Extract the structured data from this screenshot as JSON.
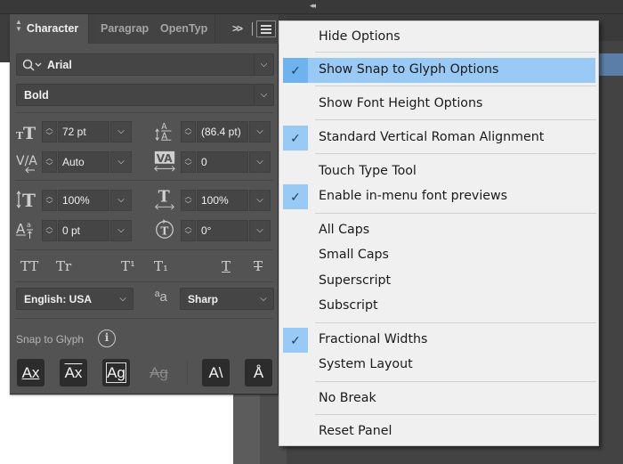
{
  "panel": {
    "tabs": [
      {
        "label": "Character",
        "active": true
      },
      {
        "label": "Paragrap",
        "active": false
      },
      {
        "label": "OpenTyp",
        "active": false
      }
    ],
    "more_tabs_icon": "double-chevron-right-icon",
    "menu_icon": "hamburger-menu-icon",
    "font_family": "Arial",
    "font_style": "Bold",
    "fields": {
      "font_size": "72 pt",
      "leading": "(86.4 pt)",
      "kerning": "Auto",
      "tracking": "0",
      "vertical_scale": "100%",
      "horizontal_scale": "100%",
      "baseline_shift": "0 pt",
      "rotation": "0°"
    },
    "style_buttons": [
      {
        "label": "TT",
        "name": "all-caps"
      },
      {
        "label": "Tr",
        "name": "small-caps"
      },
      {
        "label": "T¹",
        "name": "superscript"
      },
      {
        "label": "T₁",
        "name": "subscript"
      },
      {
        "label": "T",
        "name": "underline"
      },
      {
        "label": "T",
        "name": "strikethrough"
      }
    ],
    "language": "English: USA",
    "antialias_icon_label": "ªa",
    "antialiasing": "Sharp",
    "snap_label": "Snap to Glyph",
    "snap_buttons": [
      {
        "label": "Ax",
        "name": "snap-baseline",
        "enabled": true
      },
      {
        "label": "Ax",
        "name": "snap-x-height",
        "enabled": true
      },
      {
        "label": "Ag",
        "name": "snap-glyph-bounds",
        "enabled": true
      },
      {
        "label": "Ag",
        "name": "snap-proximity",
        "enabled": false
      },
      {
        "label": "A\\",
        "name": "snap-angular",
        "enabled": true
      },
      {
        "label": "Å",
        "name": "snap-anchor",
        "enabled": true
      }
    ]
  },
  "collapse_icon_label": "◂◂",
  "menu": {
    "items": [
      {
        "label": "Hide Options",
        "checked": false,
        "highlighted": false
      },
      {
        "label": "Show Snap to Glyph Options",
        "checked": true,
        "highlighted": true
      },
      {
        "label": "Show Font Height Options",
        "checked": false,
        "highlighted": false
      },
      {
        "label": "Standard Vertical Roman Alignment",
        "checked": true,
        "highlighted": false
      },
      {
        "label": "Touch Type Tool",
        "checked": false,
        "highlighted": false
      },
      {
        "label": "Enable in-menu font previews",
        "checked": true,
        "highlighted": false
      },
      {
        "label": "All Caps",
        "checked": false,
        "highlighted": false
      },
      {
        "label": "Small Caps",
        "checked": false,
        "highlighted": false
      },
      {
        "label": "Superscript",
        "checked": false,
        "highlighted": false
      },
      {
        "label": "Subscript",
        "checked": false,
        "highlighted": false
      },
      {
        "label": "Fractional Widths",
        "checked": true,
        "highlighted": false
      },
      {
        "label": "System Layout",
        "checked": false,
        "highlighted": false
      },
      {
        "label": "No Break",
        "checked": false,
        "highlighted": false
      },
      {
        "label": "Reset Panel",
        "checked": false,
        "highlighted": false
      }
    ],
    "check_glyph": "✓",
    "highlight_color": "#99c9f5"
  }
}
